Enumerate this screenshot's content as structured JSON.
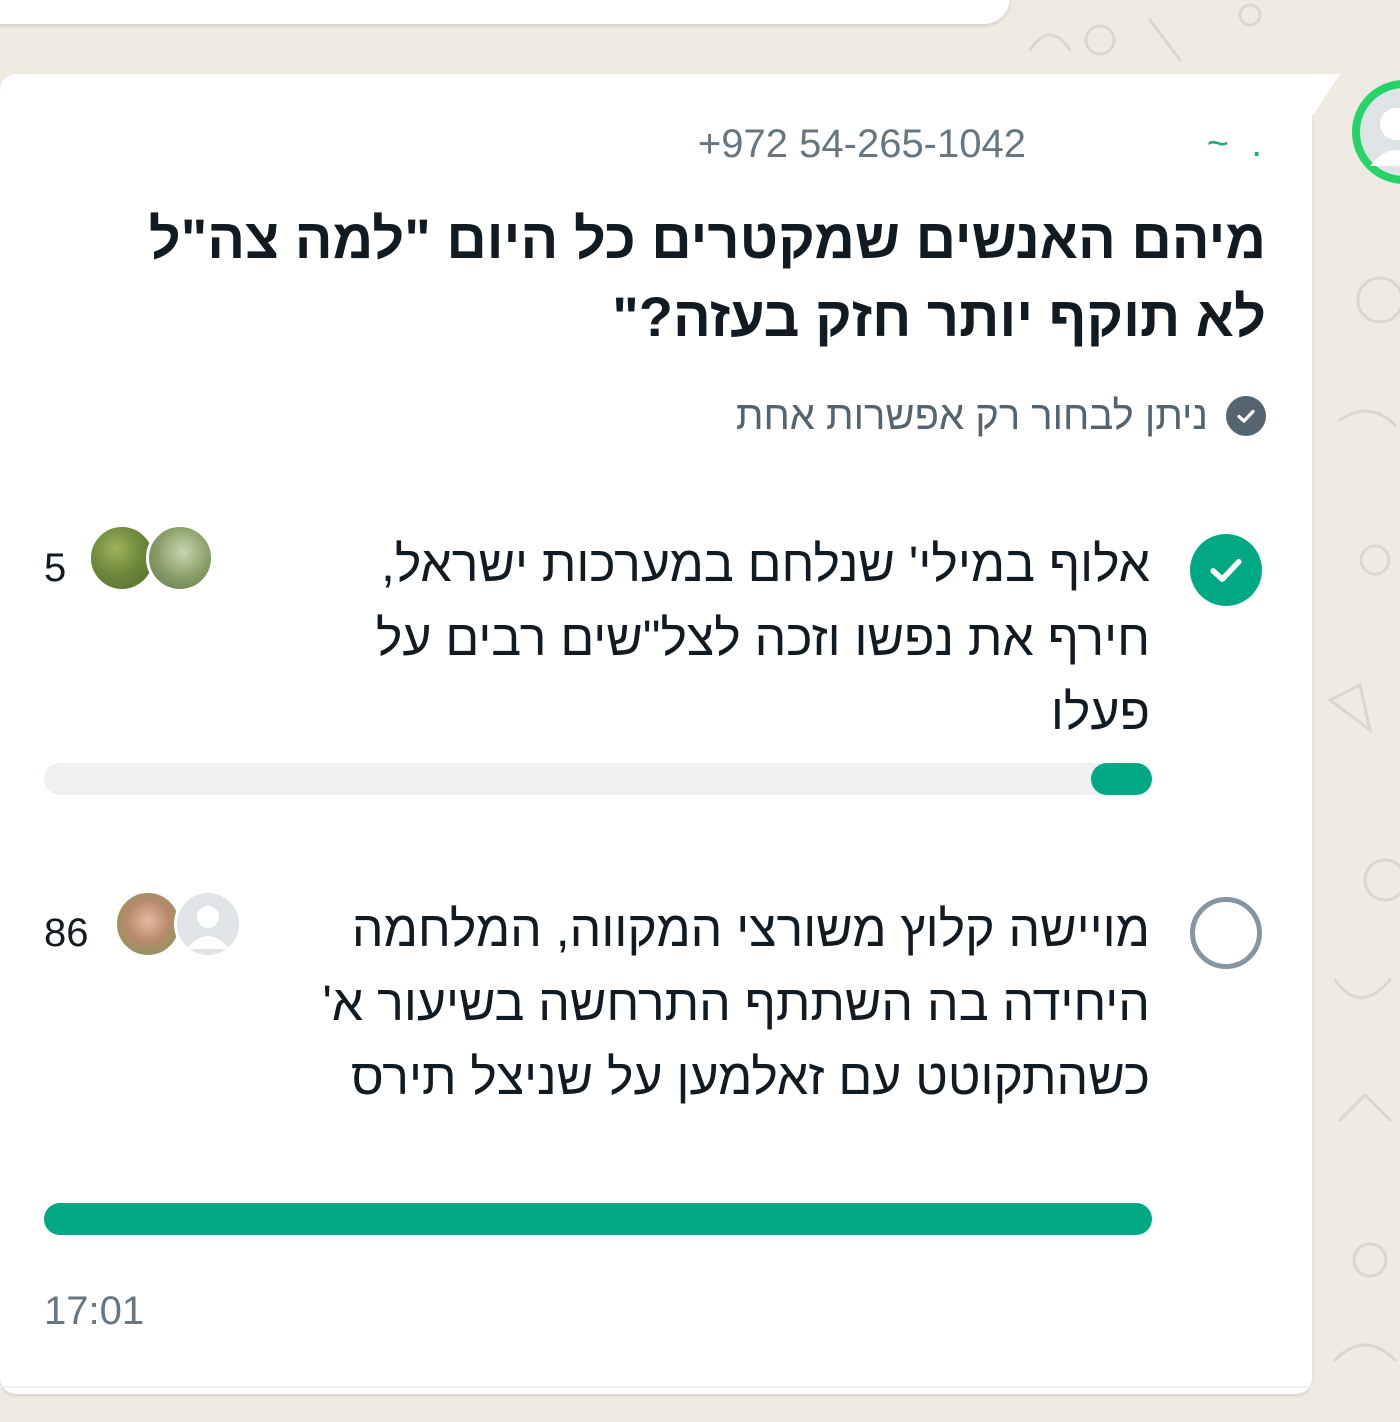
{
  "message": {
    "sender_phone": "+972 54-265-1042",
    "sender_name": "~ .",
    "time": "17:01"
  },
  "poll": {
    "question": "מיהם האנשים שמקטרים כל היום \"למה צה\"ל לא תוקף יותר חזק בעזה?\"",
    "hint": "ניתן לבחור רק אפשרות אחת",
    "options": [
      {
        "text": "אלוף במילי' שנלחם במערכות ישראל, חירף את נפשו וזכה לצל\"שים רבים על פעלו",
        "votes": "5",
        "selected": true,
        "fill_fraction": 0.055
      },
      {
        "text": "מויישה קלוץ משורצי המקווה, המלחמה היחידה בה השתתף התרחשה בשיעור א' כשהתקוטט עם זאלמען על שניצל תירס",
        "votes": "86",
        "selected": false,
        "fill_fraction": 1.0
      }
    ]
  },
  "icons": {
    "selected_option": "check-icon",
    "single_choice_hint": "check-circle-icon",
    "sender_avatar": "person-icon",
    "voter_placeholder": "person-icon"
  },
  "colors": {
    "accent": "#00a884",
    "sender_name": "#1fa885",
    "chat_background": "#efeae2",
    "bubble": "#ffffff",
    "muted_text": "#667781"
  }
}
